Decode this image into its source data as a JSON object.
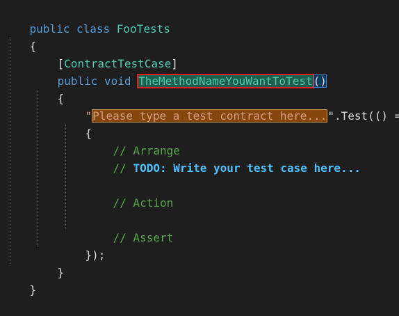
{
  "code": {
    "line1": {
      "kw1": "public",
      "kw2": "class",
      "name": "FooTests"
    },
    "line2": {
      "brace": "{"
    },
    "line3": {
      "open": "[",
      "attr": "ContractTestCase",
      "close": "]"
    },
    "line4": {
      "kw1": "public",
      "kw2": "void",
      "method": "TheMethodNameYouWantToTest",
      "parens": "()"
    },
    "line5": {
      "brace": "{"
    },
    "line6": {
      "quote_open": "\"",
      "placeholder": "Please type a test contract here...",
      "rest": "\".Test(() =>"
    },
    "line7": {
      "brace": "{"
    },
    "line8": {
      "comment": "// Arrange"
    },
    "line9": {
      "comment_prefix": "// ",
      "todo": "TODO:",
      "todo_text": " Write your test case here..."
    },
    "line11": {
      "comment": "// Action"
    },
    "line13": {
      "comment": "// Assert"
    },
    "line14": {
      "close": "});"
    },
    "line15": {
      "brace": "}"
    },
    "line16": {
      "brace": "}"
    }
  },
  "colors": {
    "background": "#1e1e1e",
    "keyword": "#569cd6",
    "type": "#4ec9b0",
    "string": "#d69d85",
    "comment": "#57a64a",
    "todo": "#4fc1ff",
    "method_highlight_bg": "#1f5e4a",
    "method_highlight_border": "#e01e1e",
    "placeholder_bg": "#87470c"
  }
}
